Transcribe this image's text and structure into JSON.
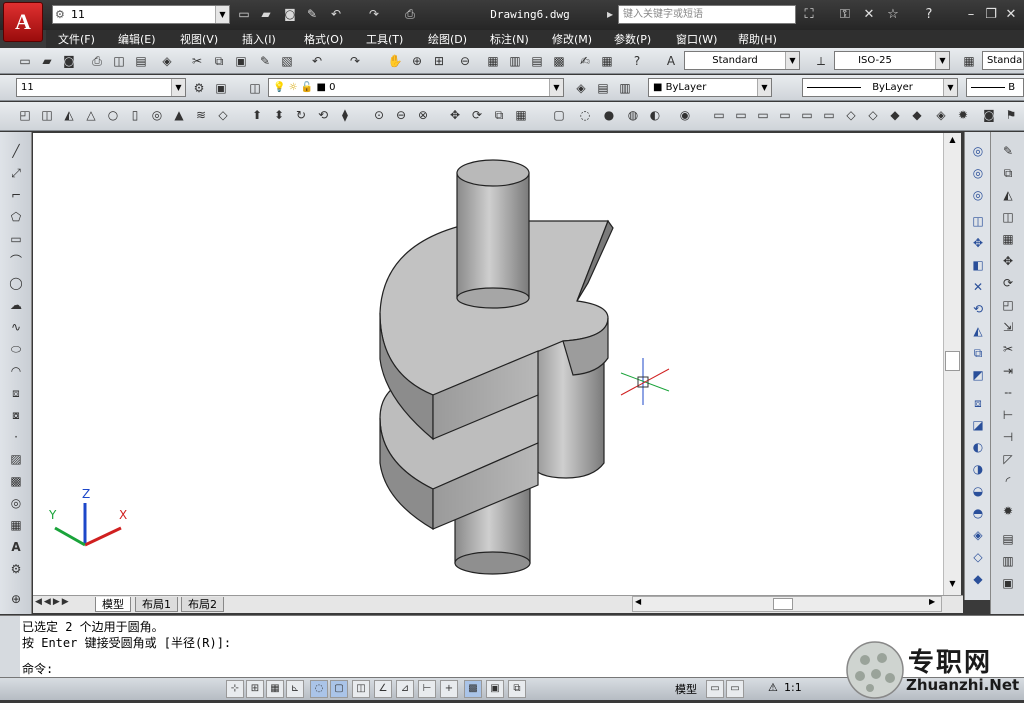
{
  "app_button": "A",
  "title": {
    "workspace": "11",
    "document": "Drawing6.dwg",
    "search_placeholder": "键入关键字或短语"
  },
  "menu": [
    "文件(F)",
    "编辑(E)",
    "视图(V)",
    "插入(I)",
    "格式(O)",
    "工具(T)",
    "绘图(D)",
    "标注(N)",
    "修改(M)",
    "参数(P)",
    "窗口(W)",
    "帮助(H)"
  ],
  "styles": {
    "text_style": "Standard",
    "dim_style": "ISO-25",
    "table_style": "Standa"
  },
  "layers": {
    "layer_state": "11",
    "current_layer": "0",
    "color": "ByLayer",
    "linetype": "ByLayer",
    "lineweight": "B"
  },
  "layout_tabs": [
    "模型",
    "布局1",
    "布局2"
  ],
  "command_lines": [
    "已选定 2 个边用于圆角。",
    "按 Enter 键接受圆角或 [半径(R)]:",
    "命令:"
  ],
  "statusbar": {
    "model_label": "模型",
    "annotation_scale": "1:1"
  },
  "watermark": {
    "text": "专职网",
    "url": "Zhuanzhi.Net"
  },
  "colors": {
    "accent": "#c41f1f",
    "ucs_x": "#d02020",
    "ucs_y": "#1aa33a",
    "ucs_z": "#1c47c9"
  }
}
